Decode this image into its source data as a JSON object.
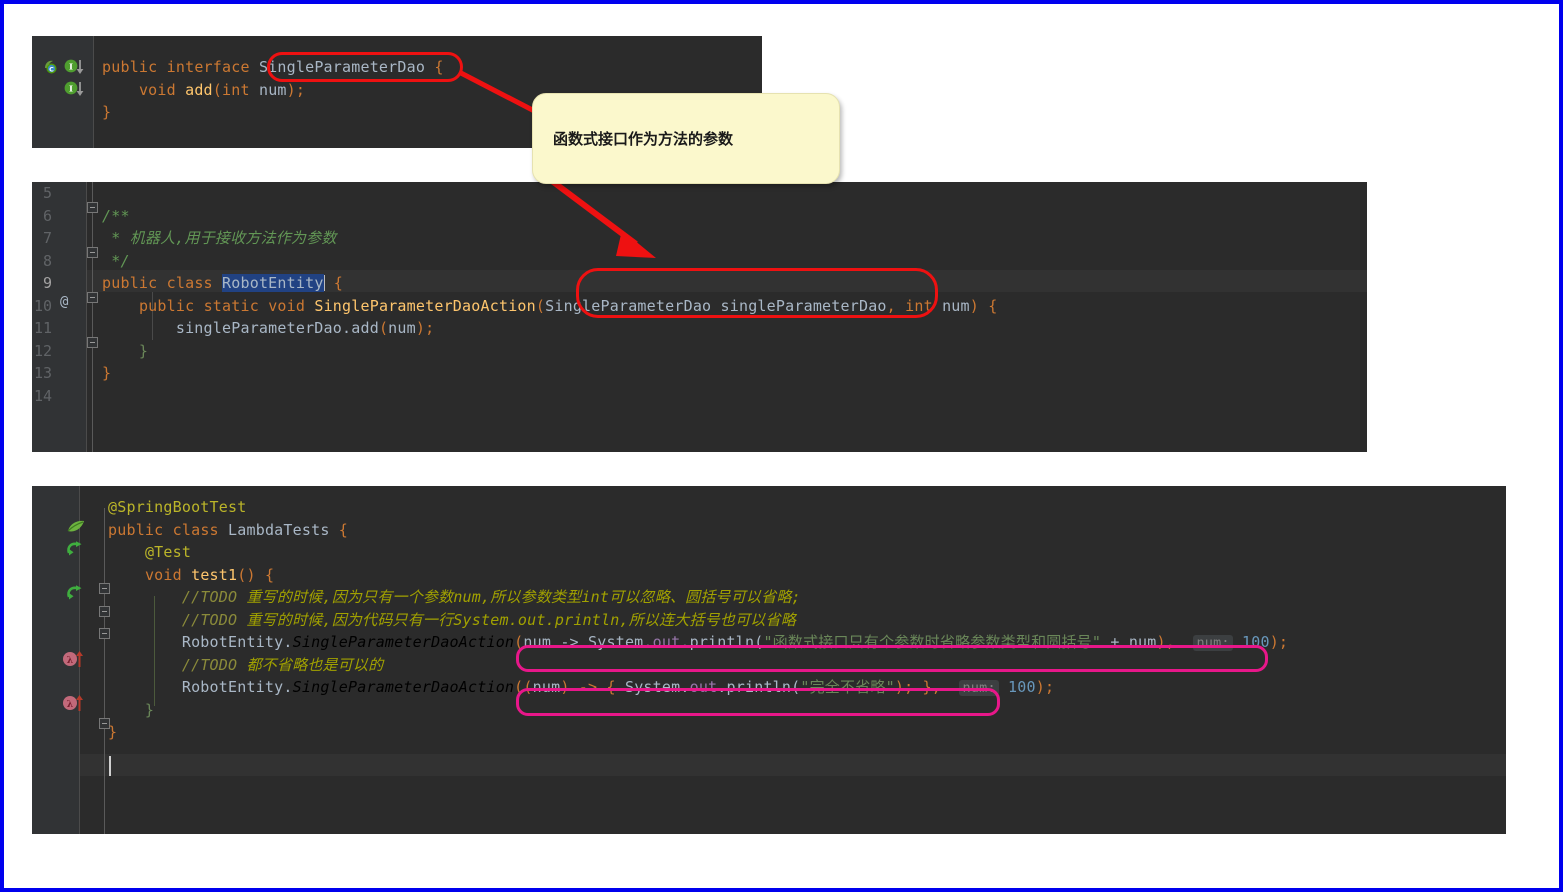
{
  "meta": {
    "frame_color": "#0000ee",
    "editor_bg": "#2b2b2b",
    "gutter_bg": "#313335",
    "red_annotation_color": "#ee1111",
    "pink_annotation_color": "#e8178a",
    "callout_bg": "#fbf8cc"
  },
  "callout": {
    "text": "函数式接口作为方法的参数"
  },
  "panel1": {
    "name": "SingleParameterDao interface",
    "gutter_icons": [
      "interface-marker-icon",
      "implemented-down-icon",
      "implemented-down-icon"
    ],
    "lines": [
      {
        "tokens": [
          {
            "t": "public ",
            "c": "kw"
          },
          {
            "t": "interface ",
            "c": "kw"
          },
          {
            "t": "SingleParameterDao",
            "c": "cls"
          },
          {
            "t": " {",
            "c": "bry"
          }
        ]
      },
      {
        "tokens": [
          {
            "t": "    ",
            "c": "txt"
          },
          {
            "t": "void ",
            "c": "kw"
          },
          {
            "t": "add",
            "c": "mth"
          },
          {
            "t": "(",
            "c": "bry"
          },
          {
            "t": "int ",
            "c": "kw"
          },
          {
            "t": "num",
            "c": "txt"
          },
          {
            "t": ");",
            "c": "bry"
          }
        ]
      },
      {
        "tokens": [
          {
            "t": "}",
            "c": "bry"
          }
        ]
      }
    ],
    "highlight_target": "SingleParameterDao"
  },
  "panel2": {
    "name": "RobotEntity class",
    "line_numbers": [
      "5",
      "6",
      "7",
      "8",
      "9",
      "10",
      "11",
      "12",
      "13",
      "14"
    ],
    "at_marker": "@",
    "lines": [
      {
        "tokens": []
      },
      {
        "tokens": [
          {
            "t": "/**",
            "c": "cmt"
          }
        ]
      },
      {
        "tokens": [
          {
            "t": " * 机器人,用于接收方法作为参数",
            "c": "cmt"
          }
        ]
      },
      {
        "tokens": [
          {
            "t": " */",
            "c": "cmt"
          }
        ]
      },
      {
        "tokens": [
          {
            "t": "public ",
            "c": "kw"
          },
          {
            "t": "class ",
            "c": "kw"
          },
          {
            "t": "RobotEntity",
            "c": "sel"
          },
          {
            "t": " {",
            "c": "bry"
          }
        ]
      },
      {
        "tokens": [
          {
            "t": "    ",
            "c": "txt"
          },
          {
            "t": "public ",
            "c": "kw"
          },
          {
            "t": "static ",
            "c": "kw"
          },
          {
            "t": "void ",
            "c": "kw"
          },
          {
            "t": "SingleParameterDaoAction",
            "c": "mth"
          },
          {
            "t": "(",
            "c": "bry"
          },
          {
            "t": "SingleParameterDao singleParameterDao",
            "c": "txt"
          },
          {
            "t": ", ",
            "c": "bry"
          },
          {
            "t": "int ",
            "c": "kw"
          },
          {
            "t": "num",
            "c": "txt"
          },
          {
            "t": ") {",
            "c": "bry"
          }
        ]
      },
      {
        "tokens": [
          {
            "t": "        singleParameterDao",
            "c": "txt"
          },
          {
            "t": ".",
            "c": "txt"
          },
          {
            "t": "add",
            "c": "txt"
          },
          {
            "t": "(",
            "c": "bry"
          },
          {
            "t": "num",
            "c": "txt"
          },
          {
            "t": ");",
            "c": "bry"
          }
        ]
      },
      {
        "tokens": [
          {
            "t": "    }",
            "c": "brg"
          }
        ]
      },
      {
        "tokens": [
          {
            "t": "}",
            "c": "bry"
          }
        ]
      },
      {
        "tokens": []
      }
    ],
    "highlight_target": "SingleParameterDao singleParameterDao"
  },
  "panel3": {
    "name": "LambdaTests test class",
    "gutter_icons": [
      "spring-leaf-icon",
      "run-test-class-icon",
      "run-test-method-icon",
      "lambda-override-up-icon",
      "lambda-override-up-icon"
    ],
    "lines": [
      {
        "tokens": [
          {
            "t": "@SpringBootTest",
            "c": "ann"
          }
        ]
      },
      {
        "tokens": [
          {
            "t": "public ",
            "c": "kw"
          },
          {
            "t": "class ",
            "c": "kw"
          },
          {
            "t": "LambdaTests",
            "c": "txt"
          },
          {
            "t": " {",
            "c": "bry"
          }
        ]
      },
      {
        "tokens": [
          {
            "t": "    ",
            "c": "txt"
          },
          {
            "t": "@Test",
            "c": "ann"
          }
        ]
      },
      {
        "tokens": [
          {
            "t": "    ",
            "c": "txt"
          },
          {
            "t": "void ",
            "c": "kw"
          },
          {
            "t": "test1",
            "c": "mth"
          },
          {
            "t": "() {",
            "c": "bry"
          }
        ]
      },
      {
        "tokens": [
          {
            "t": "        ",
            "c": "txt"
          },
          {
            "t": "//TODO ",
            "c": "todot"
          },
          {
            "t": "重写的时候,因为只有一个参数num,所以参数类型int可以忽略、圆括号可以省略;",
            "c": "todo"
          }
        ]
      },
      {
        "tokens": [
          {
            "t": "        ",
            "c": "txt"
          },
          {
            "t": "//TODO ",
            "c": "todot"
          },
          {
            "t": "重写的时候,因为代码只有一行System.out.println,所以连大括号也可以省略",
            "c": "todo"
          }
        ]
      },
      {
        "tokens": [
          {
            "t": "        RobotEntity",
            "c": "txt"
          },
          {
            "t": ".",
            "c": "txt"
          },
          {
            "t": "SingleParameterDaoAction",
            "c": "ital"
          },
          {
            "t": "(",
            "c": "bry"
          },
          {
            "t": "num -> ",
            "c": "txt"
          },
          {
            "t": "System",
            "c": "txt"
          },
          {
            "t": ".",
            "c": "txt"
          },
          {
            "t": "out",
            "c": "fld"
          },
          {
            "t": ".println(",
            "c": "txt"
          },
          {
            "t": "\"函数式接口只有个参数时省略参数类型和圆括号\"",
            "c": "str"
          },
          {
            "t": " + ",
            "c": "txt"
          },
          {
            "t": "num",
            "c": "txt"
          },
          {
            "t": "),",
            "c": "bry"
          }
        ],
        "hint": "num:",
        "hint_value": "100",
        "hint_tail": ");"
      },
      {
        "tokens": [
          {
            "t": "        ",
            "c": "txt"
          },
          {
            "t": "//TODO ",
            "c": "todot"
          },
          {
            "t": "都不省略也是可以的",
            "c": "todo"
          }
        ]
      },
      {
        "tokens": [
          {
            "t": "        RobotEntity",
            "c": "txt"
          },
          {
            "t": ".",
            "c": "txt"
          },
          {
            "t": "SingleParameterDaoAction",
            "c": "ital"
          },
          {
            "t": "((",
            "c": "bry"
          },
          {
            "t": "num",
            "c": "txt"
          },
          {
            "t": ") -> { ",
            "c": "bry"
          },
          {
            "t": "System",
            "c": "txt"
          },
          {
            "t": ".",
            "c": "txt"
          },
          {
            "t": "out",
            "c": "fld"
          },
          {
            "t": ".println(",
            "c": "txt"
          },
          {
            "t": "\"完全不省略\"",
            "c": "str"
          },
          {
            "t": "); },",
            "c": "bry"
          }
        ],
        "hint": "num:",
        "hint_value": "100",
        "hint_tail": ");"
      },
      {
        "tokens": [
          {
            "t": "    }",
            "c": "brg"
          }
        ]
      },
      {
        "tokens": [
          {
            "t": "}",
            "c": "bry"
          }
        ]
      },
      {
        "tokens": []
      }
    ],
    "highlight_targets": [
      "(num -> System.out.println(\"函数式接口只有个参数时省略参数类型和圆括号\" + num),",
      "((num) -> { System.out.println(\"完全不省略\"); },"
    ]
  }
}
